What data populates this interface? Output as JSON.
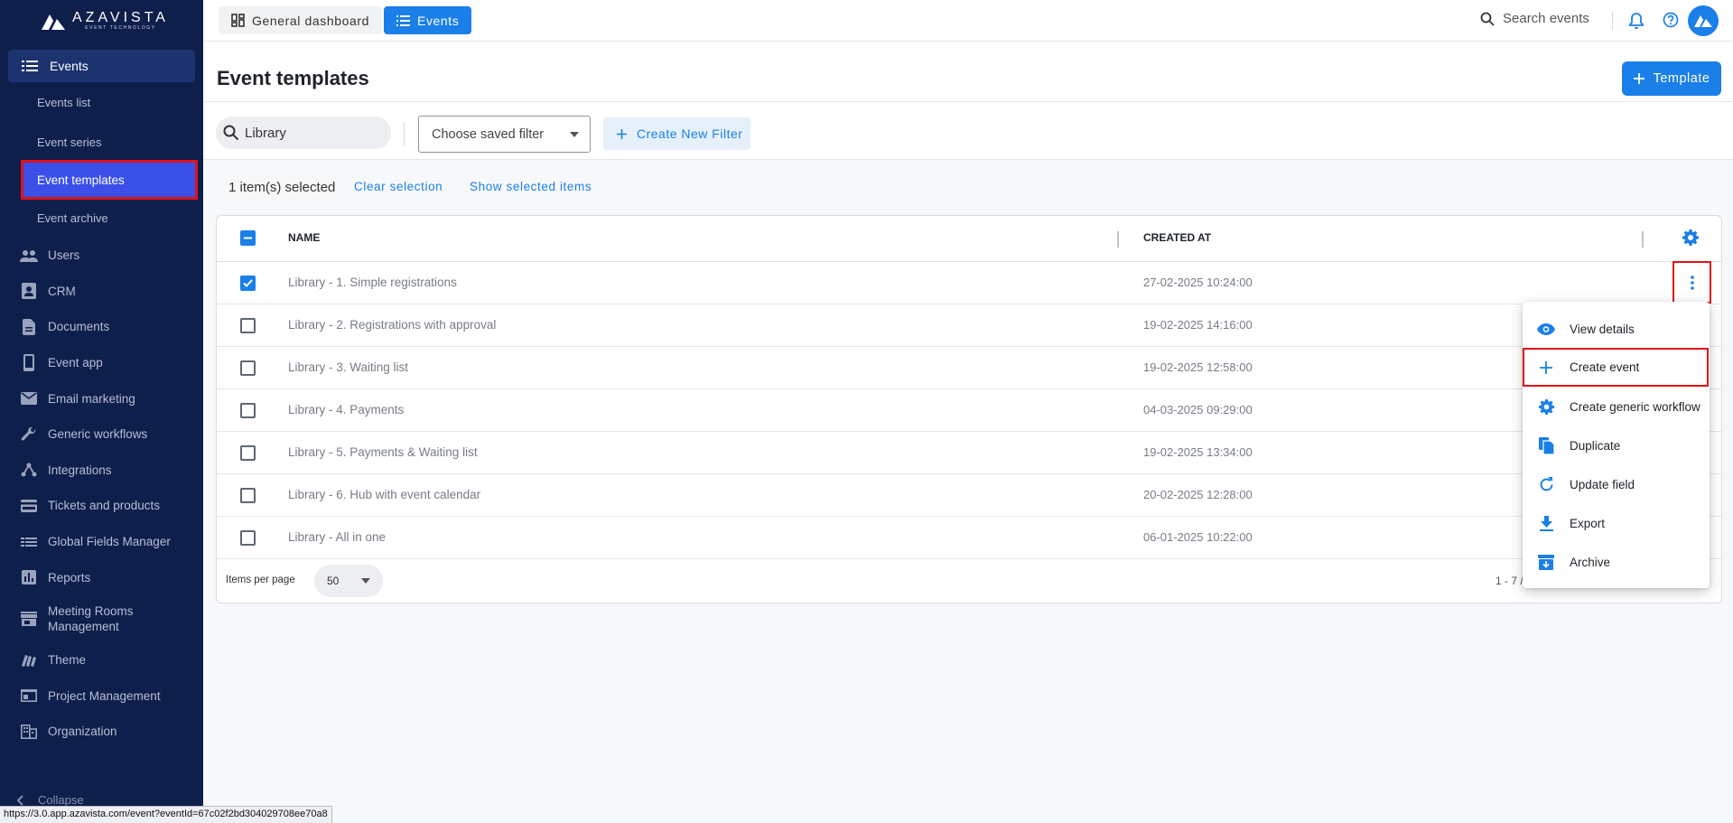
{
  "brand": {
    "name": "AZAVISTA",
    "tagline": "EVENT TECHNOLOGY"
  },
  "sidebar": {
    "section": {
      "label": "Events",
      "icon": "list-icon"
    },
    "subitems": [
      {
        "label": "Events list"
      },
      {
        "label": "Event series"
      },
      {
        "label": "Event templates",
        "active": true
      },
      {
        "label": "Event archive"
      }
    ],
    "items": [
      {
        "label": "Users",
        "icon": "users-icon"
      },
      {
        "label": "CRM",
        "icon": "contact-card-icon"
      },
      {
        "label": "Documents",
        "icon": "document-icon"
      },
      {
        "label": "Event app",
        "icon": "phone-icon"
      },
      {
        "label": "Email marketing",
        "icon": "mail-icon"
      },
      {
        "label": "Generic workflows",
        "icon": "wrench-icon"
      },
      {
        "label": "Integrations",
        "icon": "integrations-icon"
      },
      {
        "label": "Tickets and products",
        "icon": "credit-card-icon"
      },
      {
        "label": "Global Fields Manager",
        "icon": "fields-icon"
      },
      {
        "label": "Reports",
        "icon": "bar-chart-icon"
      },
      {
        "label": "Meeting Rooms Management",
        "icon": "store-icon"
      },
      {
        "label": "Theme",
        "icon": "palette-icon"
      },
      {
        "label": "Project Management",
        "icon": "project-icon"
      },
      {
        "label": "Organization",
        "icon": "building-icon"
      }
    ],
    "collapse_label": "Collapse"
  },
  "status_url": "https://3.0.app.azavista.com/event?eventId=67c02f2bd304029708ee70a8",
  "topbar": {
    "tabs": [
      {
        "label": "General dashboard",
        "icon": "dashboard-icon"
      },
      {
        "label": "Events",
        "icon": "list-icon",
        "active": true
      }
    ],
    "search_label": "Search events"
  },
  "page": {
    "title": "Event templates",
    "add_button": "Template"
  },
  "filters": {
    "search_value": "Library",
    "saved_filter_label": "Choose saved filter",
    "create_filter_label": "Create New Filter"
  },
  "selection": {
    "count_text": "1 item(s) selected",
    "clear_label": "Clear selection",
    "show_label": "Show selected items"
  },
  "table": {
    "columns": {
      "name": "NAME",
      "created": "CREATED AT"
    },
    "rows": [
      {
        "name": "Library - 1. Simple registrations",
        "created": "27-02-2025 10:24:00",
        "checked": true
      },
      {
        "name": "Library - 2. Registrations with approval",
        "created": "19-02-2025 14:16:00",
        "checked": false
      },
      {
        "name": "Library - 3. Waiting list",
        "created": "19-02-2025 12:58:00",
        "checked": false
      },
      {
        "name": "Library - 4. Payments",
        "created": "04-03-2025 09:29:00",
        "checked": false
      },
      {
        "name": "Library - 5. Payments & Waiting list",
        "created": "19-02-2025 13:34:00",
        "checked": false
      },
      {
        "name": "Library - 6. Hub with event calendar",
        "created": "20-02-2025 12:28:00",
        "checked": false
      },
      {
        "name": "Library - All in one",
        "created": "06-01-2025 10:22:00",
        "checked": false
      }
    ],
    "items_per_page_label": "Items per page",
    "items_per_page": "50",
    "range_text": "1 - 7 /"
  },
  "context_menu": {
    "items": [
      {
        "label": "View details",
        "icon": "eye-icon"
      },
      {
        "label": "Create event",
        "icon": "plus-icon",
        "highlighted": true
      },
      {
        "label": "Create generic workflow",
        "icon": "gear-icon"
      },
      {
        "label": "Duplicate",
        "icon": "duplicate-icon"
      },
      {
        "label": "Update field",
        "icon": "refresh-icon"
      },
      {
        "label": "Export",
        "icon": "download-icon"
      },
      {
        "label": "Archive",
        "icon": "archive-icon"
      }
    ]
  },
  "colors": {
    "sidebar": "#0f1f4b",
    "accent": "#1a7fe8",
    "active_nav": "#3a50e8",
    "highlight_border": "#e0121a"
  }
}
